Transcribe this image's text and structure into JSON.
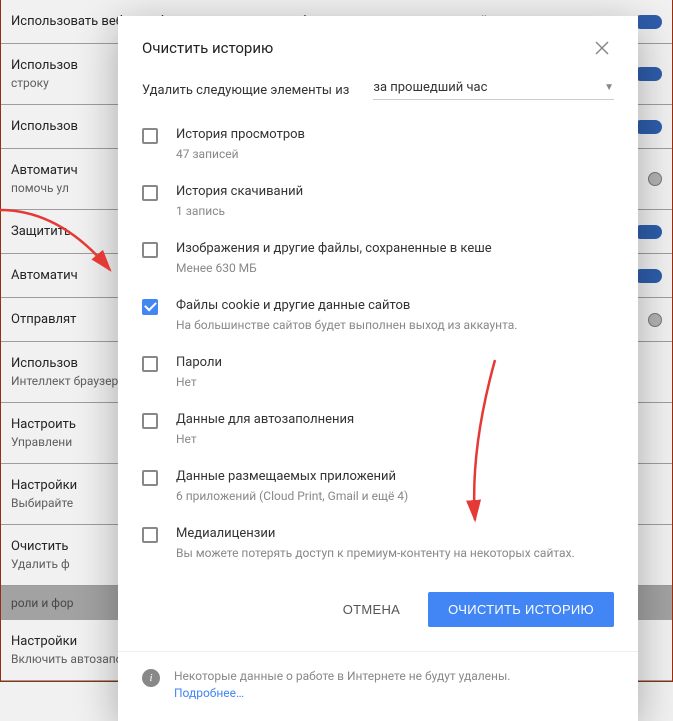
{
  "bg": {
    "rows": [
      {
        "t": "Использовать веб-службу для разрешения проблем, связанных с навигацией",
        "s": "",
        "tog": "on"
      },
      {
        "t": "Использов",
        "s": "строку",
        "tog": "on"
      },
      {
        "t": "Использов",
        "s": "",
        "tog": "on"
      },
      {
        "t": "Автоматич",
        "s": "помочь ул",
        "tog": "off"
      },
      {
        "t": "Защитить",
        "s": "",
        "tog": "on"
      },
      {
        "t": "Автоматич",
        "s": "",
        "tog": "on"
      },
      {
        "t": "Отправлят",
        "s": "",
        "tog": "off"
      },
      {
        "t": "Использов",
        "s": "Интеллект браузере,",
        "tog": ""
      },
      {
        "t": "Настроить",
        "s": "Управлени",
        "tog": ""
      },
      {
        "t": "Настройки",
        "s": "Выбирайте",
        "tog": ""
      },
      {
        "t": "Очистить",
        "s": "Удалить ф",
        "tog": ""
      }
    ],
    "section": "роли и фор",
    "last_t": "Настройки",
    "last_s": "Включить автозаполнение для быстрого добавления данных в веб-формы"
  },
  "dialog": {
    "title": "Очистить историю",
    "range_label": "Удалить следующие элементы из",
    "range_value": "за прошедший час",
    "items": [
      {
        "title": "История просмотров",
        "sub": "47 записей",
        "checked": false
      },
      {
        "title": "История скачиваний",
        "sub": "1 запись",
        "checked": false
      },
      {
        "title": "Изображения и другие файлы, сохраненные в кеше",
        "sub": "Менее 630 МБ",
        "checked": false
      },
      {
        "title": "Файлы cookie и другие данные сайтов",
        "sub": "На большинстве сайтов будет выполнен выход из аккаунта.",
        "checked": true
      },
      {
        "title": "Пароли",
        "sub": "Нет",
        "checked": false
      },
      {
        "title": "Данные для автозаполнения",
        "sub": "Нет",
        "checked": false
      },
      {
        "title": "Данные размещаемых приложений",
        "sub": "6 приложений (Cloud Print, Gmail и ещё 4)",
        "checked": false
      },
      {
        "title": "Медиалицензии",
        "sub": "Вы можете потерять доступ к премиум-контенту на некоторых сайтах.",
        "checked": false
      }
    ],
    "cancel": "Отмена",
    "confirm": "Очистить историю",
    "note": "Некоторые данные о работе в Интернете не будут удалены.",
    "learn": "Подробнее…"
  }
}
